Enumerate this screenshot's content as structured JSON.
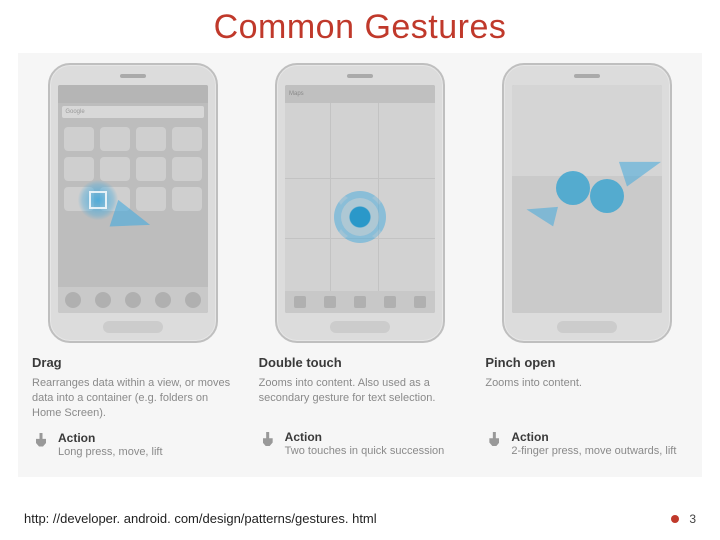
{
  "title": "Common Gestures",
  "gestures": [
    {
      "name": "Drag",
      "description": "Rearranges data within a view, or moves data into a container (e.g. folders on Home Screen).",
      "action_label": "Action",
      "action_text": "Long press, move, lift"
    },
    {
      "name": "Double touch",
      "description": "Zooms into content. Also used as a secondary gesture for text selection.",
      "action_label": "Action",
      "action_text": "Two touches in quick succession"
    },
    {
      "name": "Pinch open",
      "description": "Zooms into content.",
      "action_label": "Action",
      "action_text": "2-finger press, move outwards, lift"
    }
  ],
  "phone1_search": "Google",
  "phone2_title": "Maps",
  "source_url": "http: //developer. android. com/design/patterns/gestures. html",
  "page_number": "3"
}
